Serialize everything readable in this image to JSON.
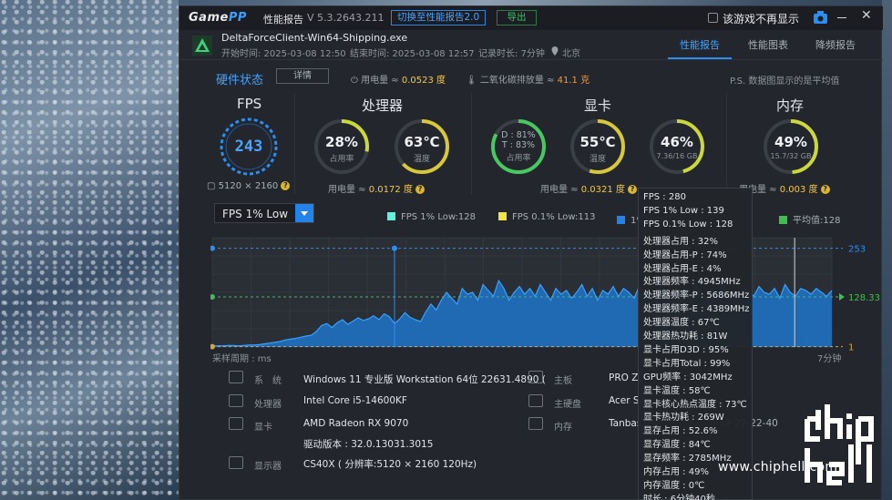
{
  "app": {
    "logo_a": "Game",
    "logo_b": "PP",
    "title": "性能报告",
    "version": "V 5.3.2643.211",
    "switch_btn": "切换至性能报告2.0",
    "export_btn": "导出",
    "no_show_label": "该游戏不再显示",
    "close": "✕"
  },
  "game": {
    "exe": "DeltaForceClient-Win64-Shipping.exe",
    "start": "开始时间: 2025-03-08 12:50",
    "end": "结束时间: 2025-03-08 12:57",
    "duration": "记录时长: 7分钟",
    "location": "北京"
  },
  "tabs": [
    "性能报告",
    "性能图表",
    "降频报告"
  ],
  "hardware": {
    "title": "硬件状态",
    "detail_btn": "详情",
    "power_label": "用电量 ≈",
    "power_value": "0.0523 度",
    "co2_label": "二氧化碳排放量 ≈",
    "co2_value": "41.1 克",
    "note": "P.S. 数据图显示的是平均值"
  },
  "fps": {
    "title": "FPS",
    "value": "243",
    "resolution": "5120 × 2160"
  },
  "cpu": {
    "title": "处理器",
    "usage": "28%",
    "usage_sub": "占用率",
    "temp": "63℃",
    "temp_sub": "温度",
    "power_label": "用电量 ≈",
    "power_value": "0.0172 度",
    "usage_fill": 0.28,
    "temp_fill": 0.63
  },
  "gpu": {
    "title": "显卡",
    "d": "D : 81%",
    "t": "T : 83%",
    "usage_sub": "占用率",
    "temp": "55℃",
    "temp_sub": "温度",
    "vram": "46%",
    "vram_sub": "7.36/16 GB",
    "power_label": "用电量 ≈",
    "power_value": "0.0321 度",
    "usage_fill": 0.83,
    "temp_fill": 0.55,
    "vram_fill": 0.46
  },
  "mem": {
    "title": "内存",
    "usage": "49%",
    "sub": "15.7/32 GB",
    "power_label": "用电量 ≈",
    "power_value": "0.003 度",
    "fill": 0.49
  },
  "chart_ctrl": {
    "selector": "FPS 1% Low",
    "legend": [
      {
        "label": "FPS 1% Low:128",
        "color": "#5ff0e0"
      },
      {
        "label": "FPS 0.1% Low:113",
        "color": "#f2e24a"
      },
      {
        "label": "1%最小帧",
        "color": "#2383e8"
      },
      {
        "label": "平均值:128",
        "color": "#3fbf4f"
      }
    ]
  },
  "chart_data": {
    "type": "line",
    "series": [
      {
        "name": "FPS 1% Low",
        "values": [
          3,
          3,
          3,
          4,
          4,
          3,
          4,
          5,
          5,
          6,
          8,
          10,
          12,
          14,
          18,
          20,
          22,
          25,
          28,
          30,
          40,
          55,
          60,
          50,
          62,
          70,
          58,
          66,
          75,
          68,
          72,
          80,
          70,
          85,
          78,
          60,
          72,
          88,
          76,
          70,
          65,
          90,
          110,
          95,
          120,
          140,
          125,
          110,
          150,
          135,
          140,
          120,
          160,
          145,
          130,
          170,
          150,
          120,
          140,
          155,
          135,
          150,
          130,
          160,
          140,
          120,
          150,
          135,
          145,
          125,
          140,
          160,
          130,
          150,
          120,
          145,
          135,
          155,
          130,
          150,
          140,
          125,
          155,
          135,
          145,
          130,
          160,
          140,
          125,
          150,
          135,
          145,
          130,
          155,
          140,
          120,
          150,
          130,
          160,
          135,
          140,
          125,
          150,
          145,
          130,
          155,
          140,
          135,
          150,
          125,
          160,
          140,
          130,
          150,
          145,
          135,
          150,
          140,
          130,
          145
        ]
      }
    ],
    "avg_value": 128.33,
    "max_value": 253,
    "min_value": 1,
    "axis_labels": {
      "max": "253",
      "avg": "128.33",
      "min": "1"
    },
    "ylim": [
      0,
      280
    ],
    "xlabel_left": "采样周期 : ms",
    "xlabel_right": "7分钟"
  },
  "system": {
    "os_lbl": "系　统",
    "os": "Windows 11 专业版 Workstation 64位 22631.4890 (",
    "cpu_lbl": "处理器",
    "cpu": "Intel Core i5-14600KF",
    "gpu_lbl": "显卡",
    "gpu": "AMD Radeon RX 9070",
    "driver": "驱动版本 : 32.0.13031.3015",
    "monitor_lbl": "显示器",
    "monitor": "CS40X ( 分辨率:5120 × 2160 120Hz)",
    "board_lbl": "主板",
    "board": "PRO Z(",
    "disk_lbl": "主硬盘",
    "disk": "Acer S",
    "ram_lbl": "内存",
    "ram": "Tanbas",
    "ram_tail": "18-22-22-40"
  },
  "tooltip": [
    "FPS : 280",
    "FPS 1% Low : 139",
    "FPS 0.1% Low : 128",
    "处理器占用 : 32%",
    "处理器占用-P : 74%",
    "处理器占用-E : 4%",
    "处理器频率 : 4945MHz",
    "处理器频率-P : 5686MHz",
    "处理器频率-E : 4389MHz",
    "处理器温度 : 67℃",
    "处理器热功耗 : 81W",
    "显卡占用D3D : 95%",
    "显卡占用Total : 99%",
    "GPU频率 : 3042MHz",
    "显卡温度 : 58℃",
    "显卡核心热点温度 : 73℃",
    "显卡热功耗 : 269W",
    "显存占用 : 52.6%",
    "显存温度 : 84℃",
    "显存频率 : 2785MHz",
    "内存占用 : 49%",
    "内存温度 : 0℃",
    "时长 : 6分钟40秒"
  ],
  "watermark": {
    "url": "www.chiphell.com"
  }
}
